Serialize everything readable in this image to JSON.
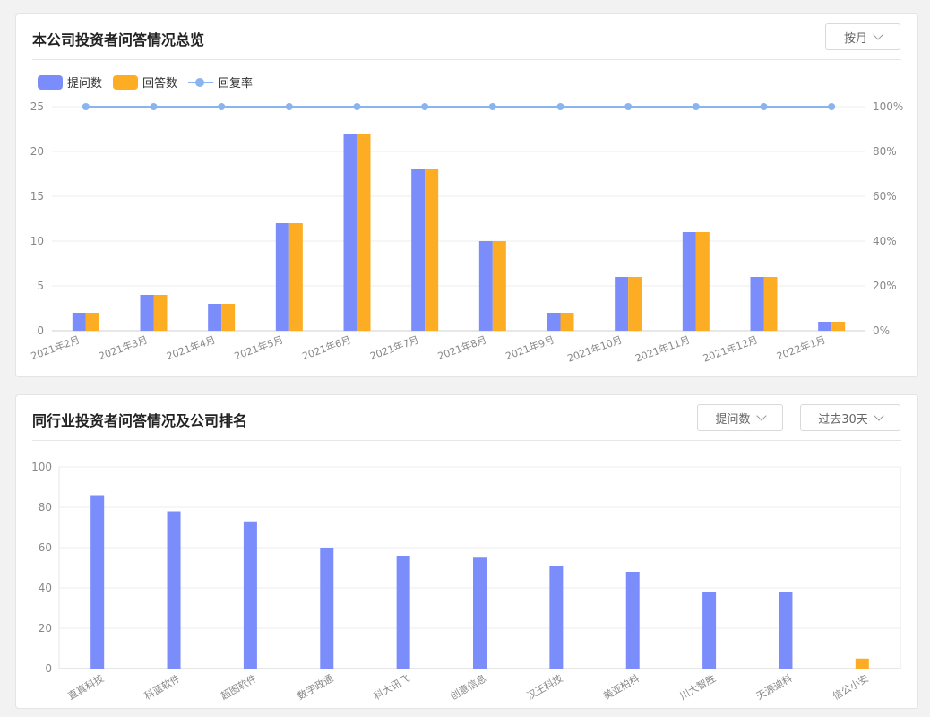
{
  "panel1": {
    "title": "本公司投资者问答情况总览",
    "dropdown_label": "按月",
    "legend": {
      "questions": "提问数",
      "answers": "回答数",
      "rate": "回复率"
    }
  },
  "panel2": {
    "title": "同行业投资者问答情况及公司排名",
    "metric_dropdown_label": "提问数",
    "period_dropdown_label": "过去30天"
  },
  "colors": {
    "questions": "#7b8cfb",
    "answers": "#fcad23",
    "rate": "#8ab4f0"
  },
  "chart_data": [
    {
      "type": "bar",
      "categories": [
        "2021年2月",
        "2021年3月",
        "2021年4月",
        "2021年5月",
        "2021年6月",
        "2021年7月",
        "2021年8月",
        "2021年9月",
        "2021年10月",
        "2021年11月",
        "2021年12月",
        "2022年1月"
      ],
      "series": [
        {
          "name": "提问数",
          "type": "bar",
          "values": [
            2,
            4,
            3,
            12,
            22,
            18,
            10,
            2,
            6,
            11,
            6,
            1
          ]
        },
        {
          "name": "回答数",
          "type": "bar",
          "values": [
            2,
            4,
            3,
            12,
            22,
            18,
            10,
            2,
            6,
            11,
            6,
            1
          ]
        },
        {
          "name": "回复率",
          "type": "line",
          "axis": "right",
          "values": [
            100,
            100,
            100,
            100,
            100,
            100,
            100,
            100,
            100,
            100,
            100,
            100
          ]
        }
      ],
      "ylim": [
        0,
        25
      ],
      "yticks": [
        0,
        5,
        10,
        15,
        20,
        25
      ],
      "y2lim": [
        0,
        100
      ],
      "y2ticks": [
        "0%",
        "20%",
        "40%",
        "60%",
        "80%",
        "100%"
      ],
      "grid": true,
      "legend": "top-left"
    },
    {
      "type": "bar",
      "categories": [
        "直真科技",
        "科蓝软件",
        "超图软件",
        "数字政通",
        "科大讯飞",
        "创意信息",
        "汉王科技",
        "美亚柏科",
        "川大智胜",
        "天源迪科",
        "信公小安"
      ],
      "values": [
        86,
        78,
        73,
        60,
        56,
        55,
        51,
        48,
        38,
        38,
        5
      ],
      "highlight_index": 10,
      "ylim": [
        0,
        100
      ],
      "yticks": [
        0,
        20,
        40,
        60,
        80,
        100
      ],
      "grid": true
    }
  ]
}
